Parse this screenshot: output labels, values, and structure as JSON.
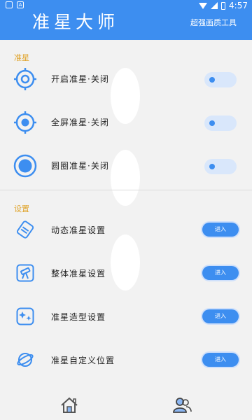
{
  "status_bar": {
    "left_icons": [
      "image-icon",
      "text-a-icon"
    ],
    "a_glyph": "A",
    "time": "4:57"
  },
  "header": {
    "title": "准星大师",
    "subtitle": "超强画质工具"
  },
  "sections": {
    "crosshair": {
      "label": "准星",
      "items": [
        {
          "label": "开启准星·关闭",
          "icon": "crosshair-ring-icon",
          "toggle": "off"
        },
        {
          "label": "全屏准星·关闭",
          "icon": "crosshair-fullscreen-icon",
          "toggle": "off"
        },
        {
          "label": "圆圈准星·关闭",
          "icon": "circle-crosshair-icon",
          "toggle": "off"
        }
      ]
    },
    "settings": {
      "label": "设置",
      "items": [
        {
          "label": "动态准星设置",
          "icon": "dynamic-crosshair-icon",
          "button": "进入"
        },
        {
          "label": "整体准星设置",
          "icon": "telescope-icon",
          "button": "进入"
        },
        {
          "label": "准星造型设置",
          "icon": "sparkle-shape-icon",
          "button": "进入"
        },
        {
          "label": "准星自定义位置",
          "icon": "planet-position-icon",
          "button": "进入"
        }
      ]
    }
  },
  "bottom_nav": [
    "home-icon",
    "users-icon"
  ],
  "colors": {
    "accent": "#3d8ef0",
    "section_label": "#e0a42c",
    "background": "#f2f2f2"
  }
}
